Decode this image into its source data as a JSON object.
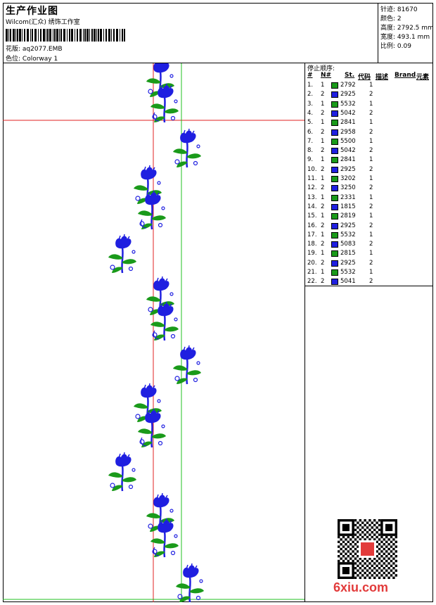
{
  "header": {
    "title": "生产作业图",
    "company": "Wilcom(汇众) 绣饰工作室",
    "design_label": "花版:",
    "design_value": "aq2077.EMB",
    "colorway_label": "色位:",
    "colorway_value": "Colorway 1"
  },
  "stats": [
    {
      "label": "针迹:",
      "value": "81670"
    },
    {
      "label": "颜色:",
      "value": "2"
    },
    {
      "label": "高度:",
      "value": "2792.5 mm"
    },
    {
      "label": "宽度:",
      "value": "493.1 mm"
    },
    {
      "label": "比例:",
      "value": "0.09"
    }
  ],
  "sequence": {
    "title": "停止顺序:",
    "columns": [
      "#",
      "N#",
      "St.",
      "代码",
      "描述",
      "Brand",
      "元素"
    ],
    "rows": [
      {
        "n": "1.",
        "id": "1",
        "st": "2792",
        "code": "1",
        "color": "#1a9a1a"
      },
      {
        "n": "2.",
        "id": "2",
        "st": "2925",
        "code": "2",
        "color": "#1f1fe0"
      },
      {
        "n": "3.",
        "id": "1",
        "st": "5532",
        "code": "1",
        "color": "#1a9a1a"
      },
      {
        "n": "4.",
        "id": "2",
        "st": "5042",
        "code": "2",
        "color": "#1f1fe0"
      },
      {
        "n": "5.",
        "id": "1",
        "st": "2841",
        "code": "1",
        "color": "#1a9a1a"
      },
      {
        "n": "6.",
        "id": "2",
        "st": "2958",
        "code": "2",
        "color": "#1f1fe0"
      },
      {
        "n": "7.",
        "id": "1",
        "st": "5500",
        "code": "1",
        "color": "#1a9a1a"
      },
      {
        "n": "8.",
        "id": "2",
        "st": "5042",
        "code": "2",
        "color": "#1f1fe0"
      },
      {
        "n": "9.",
        "id": "1",
        "st": "2841",
        "code": "1",
        "color": "#1a9a1a"
      },
      {
        "n": "10.",
        "id": "2",
        "st": "2925",
        "code": "2",
        "color": "#1f1fe0"
      },
      {
        "n": "11.",
        "id": "1",
        "st": "3202",
        "code": "1",
        "color": "#1a9a1a"
      },
      {
        "n": "12.",
        "id": "2",
        "st": "3250",
        "code": "2",
        "color": "#1f1fe0"
      },
      {
        "n": "13.",
        "id": "1",
        "st": "2331",
        "code": "1",
        "color": "#1a9a1a"
      },
      {
        "n": "14.",
        "id": "2",
        "st": "1815",
        "code": "2",
        "color": "#1f1fe0"
      },
      {
        "n": "15.",
        "id": "1",
        "st": "2819",
        "code": "1",
        "color": "#1a9a1a"
      },
      {
        "n": "16.",
        "id": "2",
        "st": "2925",
        "code": "2",
        "color": "#1f1fe0"
      },
      {
        "n": "17.",
        "id": "1",
        "st": "5532",
        "code": "1",
        "color": "#1a9a1a"
      },
      {
        "n": "18.",
        "id": "2",
        "st": "5083",
        "code": "2",
        "color": "#1f1fe0"
      },
      {
        "n": "19.",
        "id": "1",
        "st": "2815",
        "code": "1",
        "color": "#1a9a1a"
      },
      {
        "n": "20.",
        "id": "2",
        "st": "2925",
        "code": "2",
        "color": "#1f1fe0"
      },
      {
        "n": "21.",
        "id": "1",
        "st": "5532",
        "code": "1",
        "color": "#1a9a1a"
      },
      {
        "n": "22.",
        "id": "2",
        "st": "5041",
        "code": "2",
        "color": "#1f1fe0"
      }
    ]
  },
  "colors": {
    "green": "#1a9a1a",
    "blue": "#1f1fe0",
    "guide_red": "#e02020",
    "guide_green": "#20c020"
  },
  "watermark": {
    "site": "6xiu.com"
  }
}
